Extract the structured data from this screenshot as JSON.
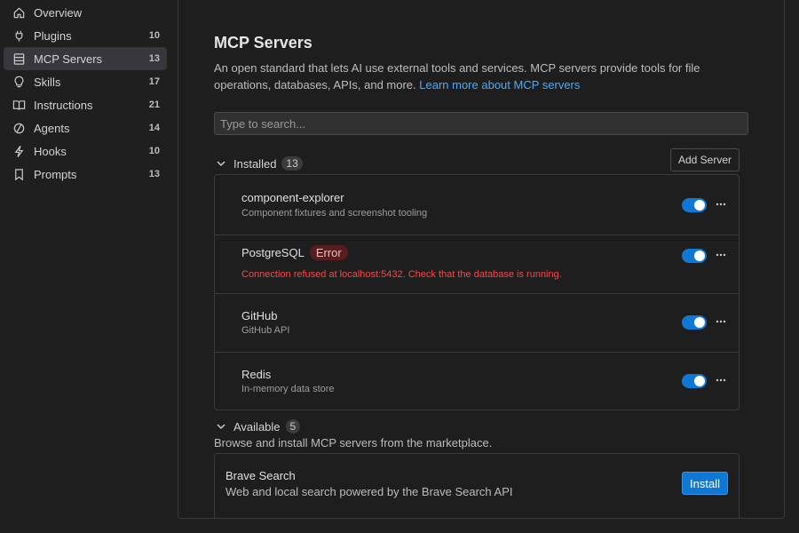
{
  "sidebar": {
    "items": [
      {
        "label": "Overview",
        "count": "",
        "icon": "home-icon"
      },
      {
        "label": "Plugins",
        "count": "10",
        "icon": "plug-icon"
      },
      {
        "label": "MCP Servers",
        "count": "13",
        "icon": "server-icon"
      },
      {
        "label": "Skills",
        "count": "17",
        "icon": "lightbulb-icon"
      },
      {
        "label": "Instructions",
        "count": "21",
        "icon": "book-icon"
      },
      {
        "label": "Agents",
        "count": "14",
        "icon": "agent-icon"
      },
      {
        "label": "Hooks",
        "count": "10",
        "icon": "lightning-icon"
      },
      {
        "label": "Prompts",
        "count": "13",
        "icon": "bookmark-icon"
      }
    ]
  },
  "main": {
    "title": "MCP Servers",
    "description": "An open standard that lets AI use external tools and services. MCP servers provide tools for file operations, databases, APIs, and more.",
    "learn_more_link": "Learn more about MCP servers",
    "search_placeholder": "Type to search...",
    "add_server_label": "Add Server",
    "installed": {
      "label": "Installed",
      "count": "13",
      "servers": [
        {
          "name": "component-explorer",
          "description": "Component fixtures and screenshot tooling",
          "enabled": true
        },
        {
          "name": "PostgreSQL",
          "badge": "Error",
          "error": "Connection refused at localhost:5432. Check that the database is running.",
          "enabled": true
        },
        {
          "name": "GitHub",
          "description": "GitHub API",
          "enabled": true
        },
        {
          "name": "Redis",
          "description": "In-memory data store",
          "enabled": true
        }
      ]
    },
    "available": {
      "label": "Available",
      "count": "5",
      "description": "Browse and install MCP servers from the marketplace.",
      "servers": [
        {
          "name": "Brave Search",
          "description": "Web and local search powered by the Brave Search API",
          "install_label": "Install"
        }
      ]
    }
  },
  "colors": {
    "accent": "#0e78d4",
    "link": "#4daafc",
    "error": "#f14c4c",
    "error_badge_bg": "#5a1d1d"
  }
}
